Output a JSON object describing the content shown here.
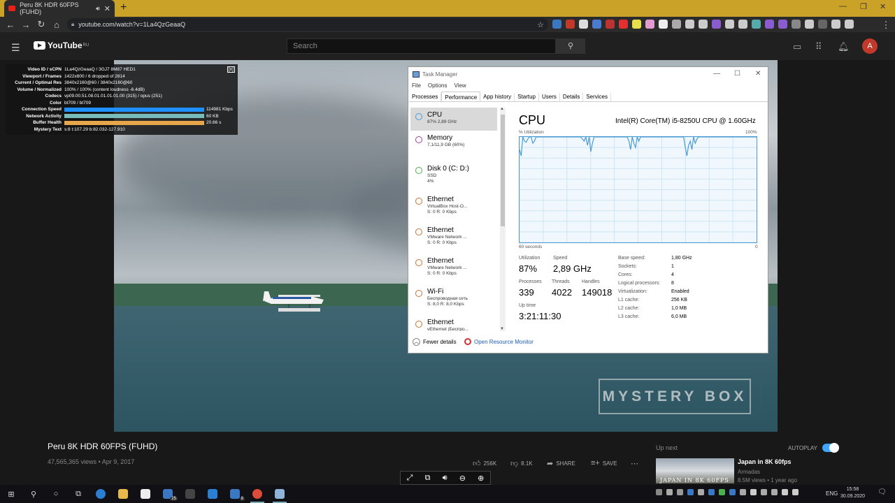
{
  "browser": {
    "tab_title": "Peru 8K HDR 60FPS (FUHD)",
    "url": "youtube.com/watch?v=1La4QzGeaaQ",
    "avatar_letter": "A"
  },
  "youtube": {
    "logo": "YouTube",
    "region": "RU",
    "search_placeholder": "Search",
    "avatar_letter": "A"
  },
  "stats": {
    "close": "[x]",
    "rows": [
      {
        "k": "Video ID / sCPN",
        "v": "1La4QzGeaaQ / 3GJ7 8M87 HED1"
      },
      {
        "k": "Viewport / Frames",
        "v": "1422x800 / 6 dropped of 2814"
      },
      {
        "k": "Current / Optimal Res",
        "v": "3840x2160@60 / 3840x2160@60"
      },
      {
        "k": "Volume / Normalized",
        "v": "100% / 100% (content loudness -6.4dB)"
      },
      {
        "k": "Codecs",
        "v": "vp09.00.51.08.01.01.01.01.00 (315) / opus (251)"
      },
      {
        "k": "Color",
        "v": "bt709 / bt709"
      },
      {
        "k": "Connection Speed",
        "v": "114981 Kbps",
        "bar": "#1e90ff"
      },
      {
        "k": "Network Activity",
        "v": "60 KB",
        "bar": "#7bb"
      },
      {
        "k": "Buffer Health",
        "v": "20.66 s",
        "bar": "#e8a64a"
      },
      {
        "k": "Mystery Text",
        "v": "s:8 t:107.29 b:82.032-127.910"
      }
    ]
  },
  "watermark": "MYSTERY BOX",
  "taskmgr": {
    "title": "Task Manager",
    "menu": [
      "File",
      "Options",
      "View"
    ],
    "tabs": [
      "Processes",
      "Performance",
      "App history",
      "Startup",
      "Users",
      "Details",
      "Services"
    ],
    "side": [
      {
        "name": "CPU",
        "l1": "87%  2,89 GHz",
        "l2": "",
        "color": "#4a9bd4"
      },
      {
        "name": "Memory",
        "l1": "7,1/11,9 GB (60%)",
        "l2": "",
        "color": "#a040a0"
      },
      {
        "name": "Disk 0 (C: D:)",
        "l1": "SSD",
        "l2": "4%",
        "color": "#4caf50"
      },
      {
        "name": "Ethernet",
        "l1": "VirtualBox Host-O...",
        "l2": "S: 0 R: 0 Kbps",
        "color": "#c87533"
      },
      {
        "name": "Ethernet",
        "l1": "VMware Network ...",
        "l2": "S: 0 R: 0 Kbps",
        "color": "#c87533"
      },
      {
        "name": "Ethernet",
        "l1": "VMware Network ...",
        "l2": "S: 0 R: 0 Kbps",
        "color": "#c87533"
      },
      {
        "name": "Wi-Fi",
        "l1": "Беспроводная сеть",
        "l2": "S: 8,0 R: 8,0 Kbps",
        "color": "#c87533"
      },
      {
        "name": "Ethernet",
        "l1": "vEthernet (Беспро...",
        "l2": "S: 0 R: 0 Kbps",
        "color": "#c87533"
      }
    ],
    "cpu_title": "CPU",
    "cpu_name": "Intel(R) Core(TM) i5-8250U CPU @ 1.60GHz",
    "util_label": "% Utilization",
    "hundred": "100%",
    "sixty": "60 seconds",
    "zero": "0",
    "utilization_label": "Utilization",
    "utilization": "87%",
    "speed_label": "Speed",
    "speed": "2,89 GHz",
    "processes_label": "Processes",
    "processes": "339",
    "threads_label": "Threads",
    "threads": "4022",
    "handles_label": "Handles",
    "handles": "149018",
    "uptime_label": "Up time",
    "uptime": "3:21:11:30",
    "specs": [
      {
        "k": "Base speed:",
        "v": "1,80 GHz"
      },
      {
        "k": "Sockets:",
        "v": "1"
      },
      {
        "k": "Cores:",
        "v": "4"
      },
      {
        "k": "Logical processors:",
        "v": "8"
      },
      {
        "k": "Virtualization:",
        "v": "Enabled"
      },
      {
        "k": "L1 cache:",
        "v": "256 KB"
      },
      {
        "k": "L2 cache:",
        "v": "1,0 MB"
      },
      {
        "k": "L3 cache:",
        "v": "6,0 MB"
      }
    ],
    "cpu_history": [
      100,
      92,
      100,
      100,
      100,
      100,
      100,
      100,
      100,
      100,
      100,
      100,
      100,
      100,
      100,
      100,
      100,
      100,
      100,
      100,
      100,
      100,
      100,
      100,
      100,
      100,
      100,
      100,
      100,
      100,
      100,
      100,
      100,
      100,
      100,
      100,
      100,
      100,
      100,
      100,
      100,
      100,
      100,
      100,
      100,
      100,
      100,
      100,
      100,
      100,
      100,
      100,
      100,
      100,
      100,
      100,
      100,
      100,
      100,
      100,
      100,
      100,
      100,
      100,
      100,
      100,
      100,
      100,
      100,
      100,
      100,
      100,
      100,
      100,
      100,
      100,
      100,
      100,
      100,
      100,
      100,
      100,
      100,
      100,
      100,
      100,
      100,
      100,
      100,
      100,
      100,
      100,
      100,
      100,
      100,
      100,
      100,
      100,
      100,
      100,
      100,
      100,
      100,
      100,
      100,
      100,
      100,
      100,
      100,
      100,
      100,
      100,
      100,
      100,
      100,
      100,
      100,
      100,
      100,
      100,
      100,
      100,
      100,
      100,
      100,
      100,
      100,
      100,
      100,
      100,
      100,
      100,
      100,
      100,
      100,
      100,
      100,
      100,
      100,
      100,
      100,
      100,
      100,
      100
    ],
    "fewer": "Fewer details",
    "orm": "Open Resource Monitor"
  },
  "video": {
    "title": "Peru 8K HDR 60FPS (FUHD)",
    "meta": "47,565,365 views • Apr 9, 2017",
    "likes": "256K",
    "dislikes": "8.1K",
    "share": "SHARE",
    "save": "SAVE"
  },
  "upnext": {
    "label": "Up next",
    "autoplay": "AUTOPLAY",
    "title": "Japan in 8K 60fps",
    "thumb_text": "JAPAN IN 8K 60FPS",
    "channel": "Armadas",
    "meta": "8.5M views • 1 year ago"
  },
  "taskbar": {
    "lang": "ENG",
    "time": "15:58",
    "date": "30.09.2020",
    "notif_count": "8"
  }
}
